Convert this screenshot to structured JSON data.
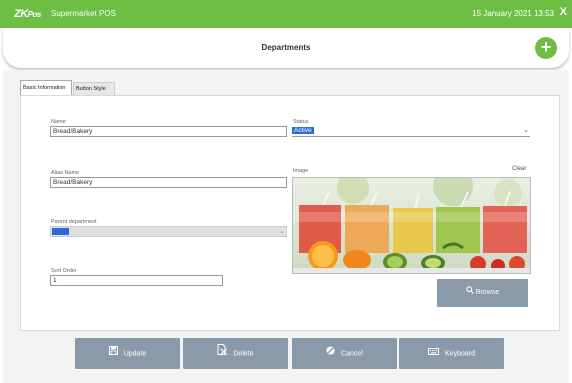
{
  "titlebar": {
    "logo": "ZK",
    "logo_suffix": "Pos",
    "app_name": "Supermarket POS",
    "datetime": "15 January 2021 13:53",
    "close": "X"
  },
  "header": {
    "title": "Departments",
    "add_label": "+"
  },
  "tabs": [
    {
      "label": "Basic Information",
      "active": true
    },
    {
      "label": "Button Style",
      "active": false
    }
  ],
  "form": {
    "name_label": "Name",
    "name_value": "Bread/Bakery",
    "alias_label": "Alias Name",
    "alias_value": "Bread/Bakery",
    "parent_label": "Parent department",
    "sort_label": "Sort Order",
    "sort_value": "1",
    "status_label": "Status",
    "status_value": "Active",
    "image_label": "Image",
    "clear_label": "Clear",
    "browse_label": "Browse"
  },
  "footer": {
    "update_label": "Update",
    "delete_label": "Delete",
    "cancel_label": "Cancel",
    "keyboard_label": "Keyboard"
  },
  "colors": {
    "brand_green": "#6fbe44",
    "button_gray": "#8b9aaa",
    "selection_blue": "#2c6bd6"
  },
  "icons": [
    "close-icon",
    "plus-icon",
    "chevron-down-icon",
    "search-icon",
    "save-icon",
    "delete-icon",
    "cancel-icon",
    "keyboard-icon"
  ]
}
